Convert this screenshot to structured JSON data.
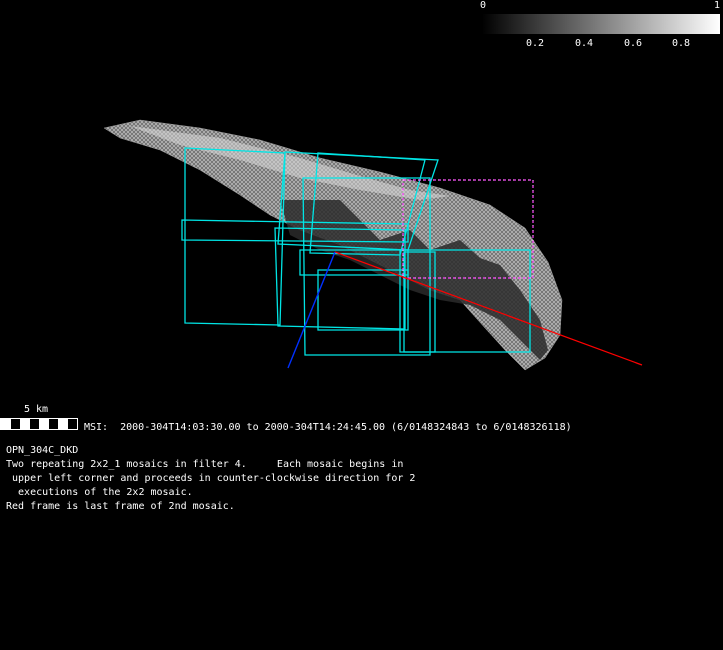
{
  "colorbar": {
    "min_label": "0",
    "max_label": "1",
    "ticks": [
      "0.2",
      "0.4",
      "0.6",
      "0.8"
    ]
  },
  "scale": {
    "label": "5 km"
  },
  "msi": {
    "line": "MSI:  2000-304T14:03:30.00 to 2000-304T14:24:45.00 (6/0148324843 to 6/0148326118)"
  },
  "description": {
    "title": "OPN_304C_DKD",
    "lines": [
      "Two repeating 2x2_1 mosaics in filter 4.     Each mosaic begins in",
      " upper left corner and proceeds in counter-clockwise direction for 2",
      "  executions of the 2x2 mosaic.",
      "Red frame is last frame of 2nd mosaic."
    ]
  },
  "colors": {
    "frame": "#00e5e5",
    "last_frame": "#ff2020",
    "sun_vector": "#ff0000",
    "axis": "#0030ff"
  }
}
